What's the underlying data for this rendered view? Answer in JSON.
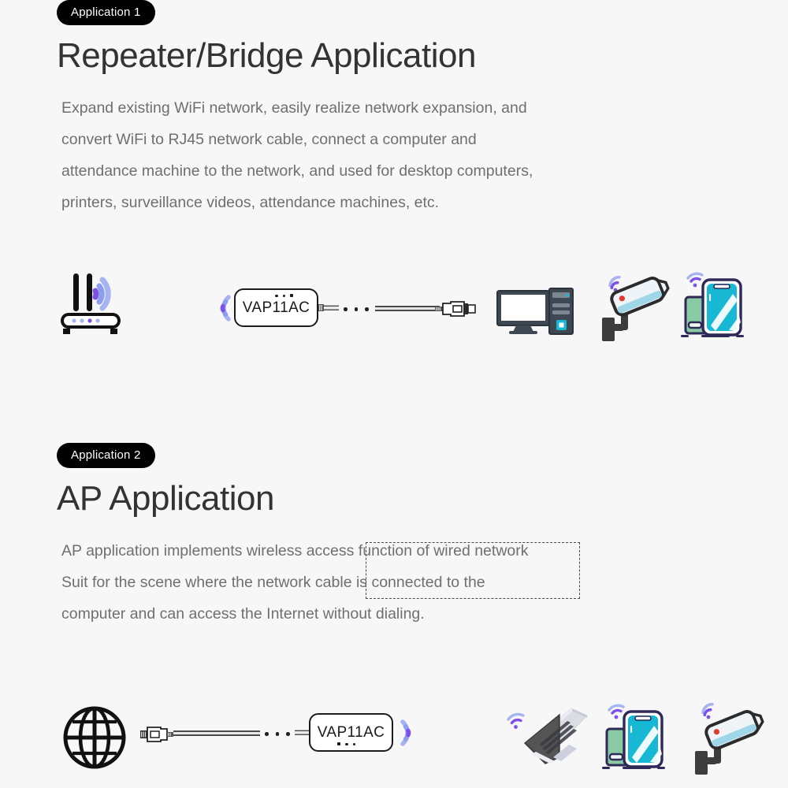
{
  "page": {
    "background": "#f7f7f7",
    "accent_purple": "#7b51e8",
    "accent_purple_light": "#a6b4f2",
    "accent_cyan": "#17b8d4",
    "text_dark": "#333333",
    "text_body": "#6f6f6f"
  },
  "sections": [
    {
      "badge": "Application 1",
      "title": "Repeater/Bridge Application",
      "paragraph_lines": [
        "Expand existing WiFi network, easily realize network expansion, and",
        "convert WiFi to RJ45 network cable, connect a computer and",
        "attendance machine to the network, and used for desktop computers,",
        "printers, surveillance videos, attendance machines, etc."
      ],
      "diagram": {
        "device_label": "VAP11AC",
        "nodes": [
          "wifi-router",
          "wifi-signal-left",
          "vap11ac-device",
          "cable-continuation-dots",
          "ethernet-cable",
          "rj45-connector",
          "desktop-monitor",
          "pc-tower",
          "security-camera",
          "smartphone"
        ]
      }
    },
    {
      "badge": "Application 2",
      "title": "AP Application",
      "paragraph_lines": [
        "AP application implements wireless access function of wired network",
        "Suit for the scene where the network cable is connected to the",
        "computer and can access the Internet without dialing."
      ],
      "diagram": {
        "device_label": "VAP11AC",
        "nodes": [
          "globe-internet",
          "rj45-connector",
          "ethernet-cable",
          "cable-continuation-dots",
          "vap11ac-device",
          "wifi-signal-right",
          "laptop",
          "smartphone",
          "security-camera"
        ]
      }
    }
  ]
}
